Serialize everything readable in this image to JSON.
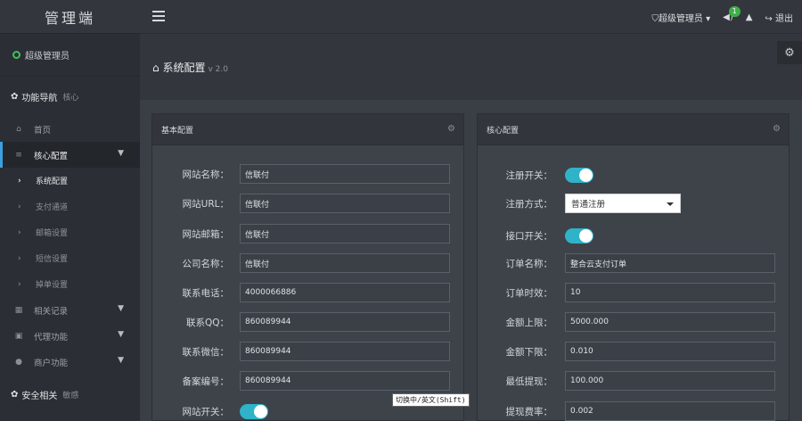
{
  "app": {
    "logo": "管理端"
  },
  "sidebar": {
    "user": "超级管理员",
    "section1": {
      "title": "功能导航",
      "sub": "核心"
    },
    "items": [
      {
        "label": "首页",
        "icon": "home-icon"
      },
      {
        "label": "核心配置",
        "icon": "sliders-icon"
      },
      {
        "label": "相关记录",
        "icon": "calendar-icon"
      },
      {
        "label": "代理功能",
        "icon": "car-icon"
      },
      {
        "label": "商户功能",
        "icon": "user-icon"
      }
    ],
    "subitems": [
      {
        "label": "系统配置"
      },
      {
        "label": "支付通道"
      },
      {
        "label": "邮箱设置"
      },
      {
        "label": "短信设置"
      },
      {
        "label": "掉单设置"
      }
    ],
    "section2": {
      "title": "安全相关",
      "sub": "敏感"
    }
  },
  "topbar": {
    "role": "超级管理员",
    "notice_count": "1",
    "logout": "退出"
  },
  "page": {
    "title": "系统配置",
    "version": "v 2.0"
  },
  "basic": {
    "title": "基本配置",
    "fields": [
      {
        "label": "网站名称：",
        "value": "信联付"
      },
      {
        "label": "网站URL：",
        "value": "信联付"
      },
      {
        "label": "网站邮箱：",
        "value": "信联付"
      },
      {
        "label": "公司名称：",
        "value": "信联付"
      },
      {
        "label": "联系电话：",
        "value": "4000066886"
      },
      {
        "label": "联系QQ：",
        "value": "860089944"
      },
      {
        "label": "联系微信：",
        "value": "860089944"
      },
      {
        "label": "备案编号：",
        "value": "860089944"
      }
    ],
    "switch_label": "网站开关："
  },
  "core": {
    "title": "核心配置",
    "register_switch_label": "注册开关：",
    "register_mode_label": "注册方式：",
    "register_mode_value": "普通注册",
    "api_switch_label": "接口开关：",
    "fields": [
      {
        "label": "订单名称：",
        "value": "整合云支付订单"
      },
      {
        "label": "订单时效：",
        "value": "10"
      },
      {
        "label": "金额上限：",
        "value": "5000.000"
      },
      {
        "label": "金额下限：",
        "value": "0.010"
      },
      {
        "label": "最低提现：",
        "value": "100.000"
      },
      {
        "label": "提现费率：",
        "value": "0.002"
      }
    ]
  },
  "tooltip": "切换中/英文(Shift)"
}
